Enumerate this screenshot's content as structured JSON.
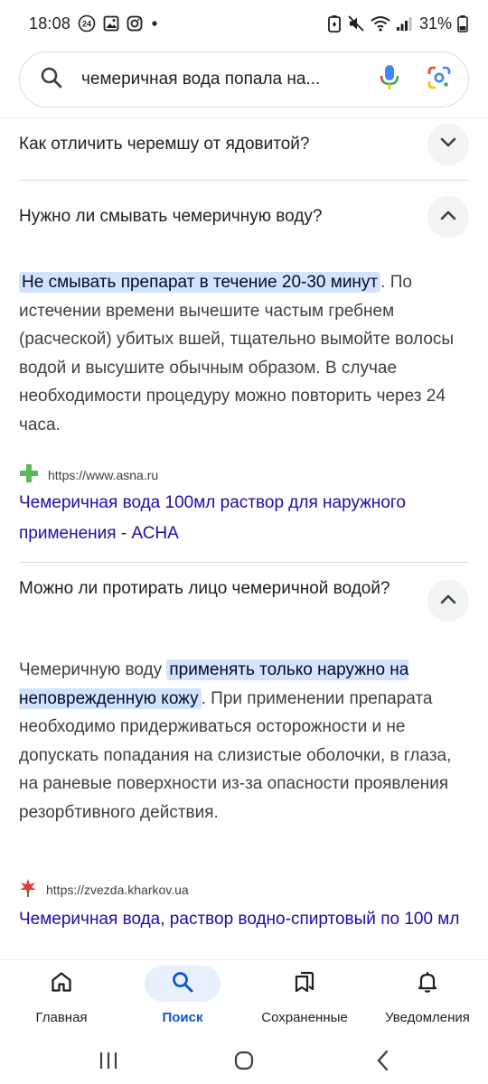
{
  "status_bar": {
    "time": "18:08",
    "notification_badge": "24",
    "battery": "31%",
    "icons": [
      "badge-24-icon",
      "gallery-icon",
      "instagram-icon",
      "dot-icon",
      "battery-saver-icon",
      "mute-icon",
      "wifi-icon",
      "signal-icon",
      "battery-icon"
    ]
  },
  "search": {
    "query": "чемеричная вода попала на..."
  },
  "faq": [
    {
      "question": "Как отличить черемшу от ядовитой?",
      "state": "collapsed"
    },
    {
      "question": "Нужно ли смывать чемеричную воду?",
      "state": "expanded",
      "answer_highlight": "Не смывать препарат в течение 20-30 минут",
      "answer_text": ". По истечении времени вычешите частым гребнем (расческой) убитых вшей, тщательно вымойте волосы водой и высушите обычным образом. В случае необходимости процедуру можно повторить через 24 часа.",
      "source_url": "https://www.asna.ru",
      "source_title": "Чемеричная вода 100мл раствор для наружного применения - АСНА"
    },
    {
      "question": "Можно ли протирать лицо чемеричной водой?",
      "state": "expanded",
      "answer_prefix": "Чемеричную воду ",
      "answer_highlight": "применять только наружно на неповрежденную кожу",
      "answer_text": ". При применении препарата необходимо придерживаться осторожности и не допускать попадания на слизистые оболочки, в глаза, на раневые поверхности из-за опасности проявления резорбтивного действия.",
      "source_url": "https://zvezda.kharkov.ua",
      "source_title": "Чемеричная вода, раствор водно-спиртовый по 100 мл"
    }
  ],
  "bottom_nav": [
    {
      "label": "Главная",
      "icon": "home-icon",
      "active": false
    },
    {
      "label": "Поиск",
      "icon": "search-icon",
      "active": true
    },
    {
      "label": "Сохраненные",
      "icon": "saved-icon",
      "active": false
    },
    {
      "label": "Уведомления",
      "icon": "bell-icon",
      "active": false
    }
  ],
  "colors": {
    "link": "#1a0dab",
    "highlight_bg": "#d3e3fd",
    "active_nav": "#0b57d0",
    "active_pill": "#e8f0fe"
  }
}
